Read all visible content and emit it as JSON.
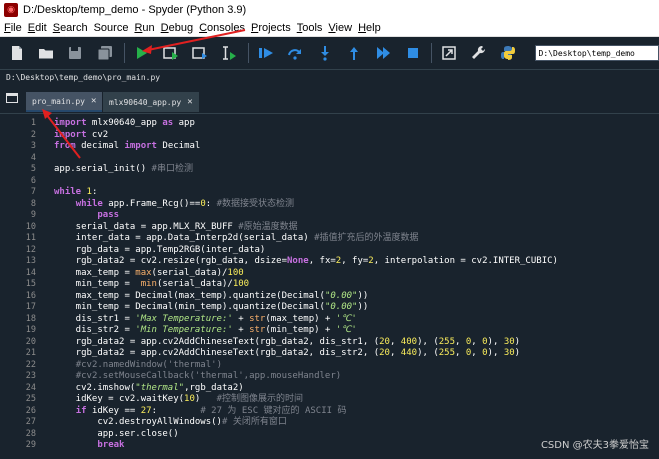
{
  "window": {
    "title": "D:/Desktop/temp_demo - Spyder (Python 3.9)"
  },
  "menu": [
    {
      "label": "File",
      "u": "F",
      "rest": "ile"
    },
    {
      "label": "Edit",
      "u": "E",
      "rest": "dit"
    },
    {
      "label": "Search",
      "u": "S",
      "rest": "earch"
    },
    {
      "label": "Source",
      "u": "",
      "rest": "Source"
    },
    {
      "label": "Run",
      "u": "R",
      "rest": "un"
    },
    {
      "label": "Debug",
      "u": "D",
      "rest": "ebug"
    },
    {
      "label": "Consoles",
      "u": "C",
      "rest": "onsoles"
    },
    {
      "label": "Projects",
      "u": "P",
      "rest": "rojects"
    },
    {
      "label": "Tools",
      "u": "T",
      "rest": "ools"
    },
    {
      "label": "View",
      "u": "V",
      "rest": "iew"
    },
    {
      "label": "Help",
      "u": "H",
      "rest": "elp"
    }
  ],
  "toolbar": {
    "icons": [
      "new-file-icon",
      "open-folder-icon",
      "save-icon",
      "save-all-icon",
      "run-icon",
      "run-cell-icon",
      "run-cell-advance-icon",
      "run-selection-icon",
      "run-cell-debug-icon",
      "step-over-icon",
      "step-into-icon",
      "step-return-icon",
      "continue-icon",
      "stop-icon",
      "maximize-pane-icon",
      "preferences-icon",
      "python-path-icon"
    ],
    "working_dir": "D:\\Desktop\\temp_demo"
  },
  "pathbar": {
    "path": "D:\\Desktop\\temp_demo\\pro_main.py"
  },
  "tabs": [
    {
      "label": "pro_main.py",
      "active": true
    },
    {
      "label": "mlx90640_app.py",
      "active": false
    }
  ],
  "code_lines": [
    {
      "n": "1",
      "segs": [
        [
          "kw",
          "import"
        ],
        [
          "nm",
          " mlx90640_app "
        ],
        [
          "kw",
          "as"
        ],
        [
          "nm",
          " app"
        ]
      ]
    },
    {
      "n": "2",
      "segs": [
        [
          "kw",
          "import"
        ],
        [
          "nm",
          " cv2"
        ]
      ]
    },
    {
      "n": "3",
      "segs": [
        [
          "kw",
          "from"
        ],
        [
          "nm",
          " decimal "
        ],
        [
          "kw",
          "import"
        ],
        [
          "nm",
          " Decimal"
        ]
      ]
    },
    {
      "n": "4",
      "segs": []
    },
    {
      "n": "5",
      "segs": [
        [
          "nm",
          "app.serial_init() "
        ],
        [
          "cm",
          "#串口检测"
        ]
      ]
    },
    {
      "n": "6",
      "segs": []
    },
    {
      "n": "7",
      "segs": [
        [
          "kw",
          "while"
        ],
        [
          "nm",
          " "
        ],
        [
          "num",
          "1"
        ],
        [
          "nm",
          ":"
        ]
      ]
    },
    {
      "n": "8",
      "segs": [
        [
          "nm",
          "    "
        ],
        [
          "kw",
          "while"
        ],
        [
          "nm",
          " app.Frame_Rcg()=="
        ],
        [
          "num",
          "0"
        ],
        [
          "nm",
          ": "
        ],
        [
          "cm",
          "#数据接受状态检测"
        ]
      ]
    },
    {
      "n": "9",
      "segs": [
        [
          "nm",
          "        "
        ],
        [
          "kw",
          "pass"
        ]
      ]
    },
    {
      "n": "10",
      "segs": [
        [
          "nm",
          "    serial_data = app.MLX_RX_BUFF "
        ],
        [
          "cm",
          "#原始温度数据"
        ]
      ]
    },
    {
      "n": "11",
      "segs": [
        [
          "nm",
          "    inter_data = app.Data_Interp2d(serial_data) "
        ],
        [
          "cm",
          "#插值扩充后的外温度数据"
        ]
      ]
    },
    {
      "n": "12",
      "segs": [
        [
          "nm",
          "    rgb_data = app.Temp2RGB(inter_data)"
        ]
      ]
    },
    {
      "n": "13",
      "segs": [
        [
          "nm",
          "    rgb_data2 = cv2.resize(rgb_data, dsize="
        ],
        [
          "kw",
          "None"
        ],
        [
          "nm",
          ", fx="
        ],
        [
          "num",
          "2"
        ],
        [
          "nm",
          ", fy="
        ],
        [
          "num",
          "2"
        ],
        [
          "nm",
          ", interpolation = cv2.INTER_CUBIC)"
        ]
      ]
    },
    {
      "n": "14",
      "segs": [
        [
          "nm",
          "    max_temp = "
        ],
        [
          "bi",
          "max"
        ],
        [
          "nm",
          "(serial_data)/"
        ],
        [
          "num",
          "100"
        ]
      ]
    },
    {
      "n": "15",
      "segs": [
        [
          "nm",
          "    min_temp =  "
        ],
        [
          "bi",
          "min"
        ],
        [
          "nm",
          "(serial_data)/"
        ],
        [
          "num",
          "100"
        ]
      ]
    },
    {
      "n": "16",
      "segs": [
        [
          "nm",
          "    max_temp = Decimal(max_temp).quantize(Decimal("
        ],
        [
          "str",
          "\"0.00\""
        ],
        [
          "nm",
          "))"
        ]
      ]
    },
    {
      "n": "17",
      "segs": [
        [
          "nm",
          "    min_temp = Decimal(min_temp).quantize(Decimal("
        ],
        [
          "str",
          "\"0.00\""
        ],
        [
          "nm",
          "))"
        ]
      ]
    },
    {
      "n": "18",
      "segs": [
        [
          "nm",
          "    dis_str1 = "
        ],
        [
          "str",
          "'Max Temperature:'"
        ],
        [
          "nm",
          " + "
        ],
        [
          "bi",
          "str"
        ],
        [
          "nm",
          "(max_temp) + "
        ],
        [
          "str",
          "'℃'"
        ]
      ]
    },
    {
      "n": "19",
      "segs": [
        [
          "nm",
          "    dis_str2 = "
        ],
        [
          "str",
          "'Min Temperature:'"
        ],
        [
          "nm",
          " + "
        ],
        [
          "bi",
          "str"
        ],
        [
          "nm",
          "(min_temp) + "
        ],
        [
          "str",
          "'℃'"
        ]
      ]
    },
    {
      "n": "20",
      "segs": [
        [
          "nm",
          "    rgb_data2 = app.cv2AddChineseText(rgb_data2, dis_str1, ("
        ],
        [
          "num",
          "20"
        ],
        [
          "nm",
          ", "
        ],
        [
          "num",
          "400"
        ],
        [
          "nm",
          "), ("
        ],
        [
          "num",
          "255"
        ],
        [
          "nm",
          ", "
        ],
        [
          "num",
          "0"
        ],
        [
          "nm",
          ", "
        ],
        [
          "num",
          "0"
        ],
        [
          "nm",
          "), "
        ],
        [
          "num",
          "30"
        ],
        [
          "nm",
          ")"
        ]
      ]
    },
    {
      "n": "21",
      "segs": [
        [
          "nm",
          "    rgb_data2 = app.cv2AddChineseText(rgb_data2, dis_str2, ("
        ],
        [
          "num",
          "20"
        ],
        [
          "nm",
          ", "
        ],
        [
          "num",
          "440"
        ],
        [
          "nm",
          "), ("
        ],
        [
          "num",
          "255"
        ],
        [
          "nm",
          ", "
        ],
        [
          "num",
          "0"
        ],
        [
          "nm",
          ", "
        ],
        [
          "num",
          "0"
        ],
        [
          "nm",
          "), "
        ],
        [
          "num",
          "30"
        ],
        [
          "nm",
          ")"
        ]
      ]
    },
    {
      "n": "22",
      "segs": [
        [
          "nm",
          "    "
        ],
        [
          "cm",
          "#cv2.namedWindow('thermal')"
        ]
      ]
    },
    {
      "n": "23",
      "segs": [
        [
          "nm",
          "    "
        ],
        [
          "cm",
          "#cv2.setMouseCallback('thermal',app.mouseHandler)"
        ]
      ]
    },
    {
      "n": "24",
      "segs": [
        [
          "nm",
          "    cv2.imshow("
        ],
        [
          "str",
          "\"thermal\""
        ],
        [
          "nm",
          ",rgb_data2)"
        ]
      ]
    },
    {
      "n": "25",
      "segs": [
        [
          "nm",
          "    idKey = cv2.waitKey("
        ],
        [
          "num",
          "10"
        ],
        [
          "nm",
          ")   "
        ],
        [
          "cm",
          "#控制图像展示的时间"
        ]
      ]
    },
    {
      "n": "26",
      "segs": [
        [
          "nm",
          "    "
        ],
        [
          "kw",
          "if"
        ],
        [
          "nm",
          " idKey == "
        ],
        [
          "num",
          "27"
        ],
        [
          "nm",
          ":        "
        ],
        [
          "cm",
          "# 27 为 ESC 键对应的 ASCII 码"
        ]
      ]
    },
    {
      "n": "27",
      "segs": [
        [
          "nm",
          "        cv2.destroyAllWindows()"
        ],
        [
          "cm",
          "# 关闭所有窗口"
        ]
      ]
    },
    {
      "n": "28",
      "segs": [
        [
          "nm",
          "        app.ser.close()"
        ]
      ]
    },
    {
      "n": "29",
      "segs": [
        [
          "nm",
          "        "
        ],
        [
          "kw",
          "break"
        ]
      ]
    }
  ],
  "watermark": "CSDN @农夫3拳爱怡宝",
  "colors": {
    "background": "#19232d",
    "keyword": "#c670e0",
    "comment": "#7f848e",
    "string": "#b0e686",
    "number": "#faed5c",
    "arrow": "#e02020"
  }
}
